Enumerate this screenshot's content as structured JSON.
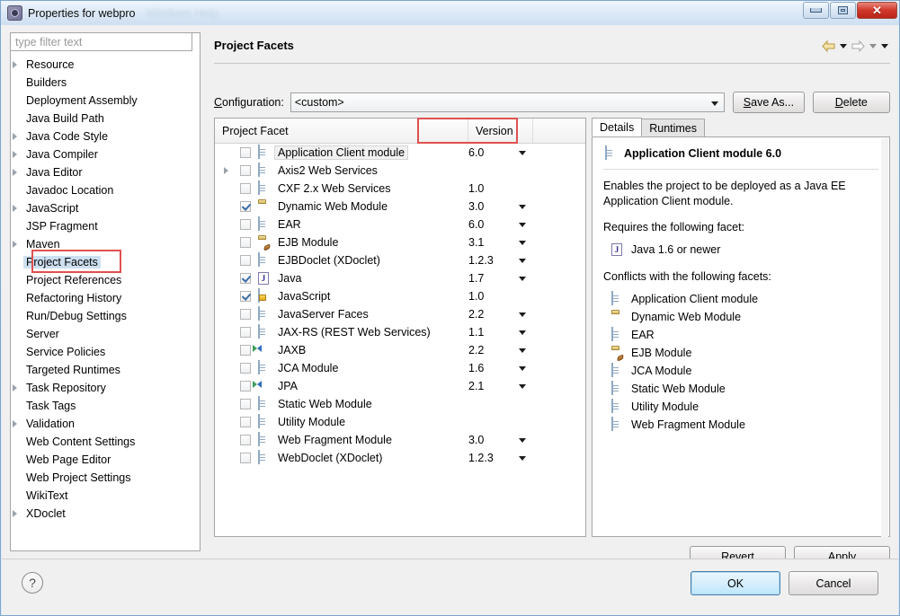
{
  "window": {
    "title": "Properties for webpro",
    "ghost_text": "Windows   Help",
    "minimize": "minimize",
    "restore": "restore",
    "close": "✕"
  },
  "sidebar": {
    "filter_placeholder": "type filter text",
    "items": [
      {
        "label": "Resource",
        "expandable": true,
        "selected": false
      },
      {
        "label": "Builders",
        "expandable": false,
        "selected": false
      },
      {
        "label": "Deployment Assembly",
        "expandable": false,
        "selected": false
      },
      {
        "label": "Java Build Path",
        "expandable": false,
        "selected": false
      },
      {
        "label": "Java Code Style",
        "expandable": true,
        "selected": false
      },
      {
        "label": "Java Compiler",
        "expandable": true,
        "selected": false
      },
      {
        "label": "Java Editor",
        "expandable": true,
        "selected": false
      },
      {
        "label": "Javadoc Location",
        "expandable": false,
        "selected": false
      },
      {
        "label": "JavaScript",
        "expandable": true,
        "selected": false
      },
      {
        "label": "JSP Fragment",
        "expandable": false,
        "selected": false
      },
      {
        "label": "Maven",
        "expandable": true,
        "selected": false
      },
      {
        "label": "Project Facets",
        "expandable": false,
        "selected": true
      },
      {
        "label": "Project References",
        "expandable": false,
        "selected": false
      },
      {
        "label": "Refactoring History",
        "expandable": false,
        "selected": false
      },
      {
        "label": "Run/Debug Settings",
        "expandable": false,
        "selected": false
      },
      {
        "label": "Server",
        "expandable": false,
        "selected": false
      },
      {
        "label": "Service Policies",
        "expandable": false,
        "selected": false
      },
      {
        "label": "Targeted Runtimes",
        "expandable": false,
        "selected": false
      },
      {
        "label": "Task Repository",
        "expandable": true,
        "selected": false
      },
      {
        "label": "Task Tags",
        "expandable": false,
        "selected": false
      },
      {
        "label": "Validation",
        "expandable": true,
        "selected": false
      },
      {
        "label": "Web Content Settings",
        "expandable": false,
        "selected": false
      },
      {
        "label": "Web Page Editor",
        "expandable": false,
        "selected": false
      },
      {
        "label": "Web Project Settings",
        "expandable": false,
        "selected": false
      },
      {
        "label": "WikiText",
        "expandable": false,
        "selected": false
      },
      {
        "label": "XDoclet",
        "expandable": true,
        "selected": false
      }
    ]
  },
  "page": {
    "title": "Project Facets",
    "nav_back_icon": "back-arrow-icon",
    "nav_forward_icon": "forward-arrow-icon"
  },
  "configuration": {
    "label": "Configuration:",
    "value": "<custom>",
    "save_as_label": "Save As...",
    "delete_label": "Delete"
  },
  "facet_table": {
    "columns": [
      "Project Facet",
      "Version",
      ""
    ],
    "rows": [
      {
        "name": "Application Client module",
        "version": "6.0",
        "checked": false,
        "has_dropdown": true,
        "expandable": false,
        "selected": true,
        "icon": "doc"
      },
      {
        "name": "Axis2 Web Services",
        "version": "",
        "checked": false,
        "has_dropdown": false,
        "expandable": true,
        "selected": false,
        "icon": "doc"
      },
      {
        "name": "CXF 2.x Web Services",
        "version": "1.0",
        "checked": false,
        "has_dropdown": false,
        "expandable": false,
        "selected": false,
        "icon": "doc"
      },
      {
        "name": "Dynamic Web Module",
        "version": "3.0",
        "checked": true,
        "has_dropdown": true,
        "expandable": false,
        "selected": false,
        "icon": "web"
      },
      {
        "name": "EAR",
        "version": "6.0",
        "checked": false,
        "has_dropdown": true,
        "expandable": false,
        "selected": false,
        "icon": "doc"
      },
      {
        "name": "EJB Module",
        "version": "3.1",
        "checked": false,
        "has_dropdown": true,
        "expandable": false,
        "selected": false,
        "icon": "ejb"
      },
      {
        "name": "EJBDoclet (XDoclet)",
        "version": "1.2.3",
        "checked": false,
        "has_dropdown": true,
        "expandable": false,
        "selected": false,
        "icon": "doc"
      },
      {
        "name": "Java",
        "version": "1.7",
        "checked": true,
        "has_dropdown": true,
        "expandable": false,
        "selected": false,
        "icon": "java"
      },
      {
        "name": "JavaScript",
        "version": "1.0",
        "checked": true,
        "has_dropdown": false,
        "expandable": false,
        "selected": false,
        "icon": "js"
      },
      {
        "name": "JavaServer Faces",
        "version": "2.2",
        "checked": false,
        "has_dropdown": true,
        "expandable": false,
        "selected": false,
        "icon": "doc"
      },
      {
        "name": "JAX-RS (REST Web Services)",
        "version": "1.1",
        "checked": false,
        "has_dropdown": true,
        "expandable": false,
        "selected": false,
        "icon": "doc"
      },
      {
        "name": "JAXB",
        "version": "2.2",
        "checked": false,
        "has_dropdown": true,
        "expandable": false,
        "selected": false,
        "icon": "arrows"
      },
      {
        "name": "JCA Module",
        "version": "1.6",
        "checked": false,
        "has_dropdown": true,
        "expandable": false,
        "selected": false,
        "icon": "doc"
      },
      {
        "name": "JPA",
        "version": "2.1",
        "checked": false,
        "has_dropdown": true,
        "expandable": false,
        "selected": false,
        "icon": "arrows"
      },
      {
        "name": "Static Web Module",
        "version": "",
        "checked": false,
        "has_dropdown": false,
        "expandable": false,
        "selected": false,
        "icon": "doc"
      },
      {
        "name": "Utility Module",
        "version": "",
        "checked": false,
        "has_dropdown": false,
        "expandable": false,
        "selected": false,
        "icon": "doc"
      },
      {
        "name": "Web Fragment Module",
        "version": "3.0",
        "checked": false,
        "has_dropdown": true,
        "expandable": false,
        "selected": false,
        "icon": "doc"
      },
      {
        "name": "WebDoclet (XDoclet)",
        "version": "1.2.3",
        "checked": false,
        "has_dropdown": true,
        "expandable": false,
        "selected": false,
        "icon": "doc"
      }
    ]
  },
  "details": {
    "tabs": [
      {
        "label": "Details",
        "active": true
      },
      {
        "label": "Runtimes",
        "active": false
      }
    ],
    "heading": "Application Client module 6.0",
    "heading_icon": "doc",
    "description": "Enables the project to be deployed as a Java EE Application Client module.",
    "requires_label": "Requires the following facet:",
    "requires": [
      {
        "label": "Java 1.6 or newer",
        "icon": "java"
      }
    ],
    "conflicts_label": "Conflicts with the following facets:",
    "conflicts": [
      {
        "label": "Application Client module",
        "icon": "doc"
      },
      {
        "label": "Dynamic Web Module",
        "icon": "web"
      },
      {
        "label": "EAR",
        "icon": "doc"
      },
      {
        "label": "EJB Module",
        "icon": "ejb"
      },
      {
        "label": "JCA Module",
        "icon": "doc"
      },
      {
        "label": "Static Web Module",
        "icon": "doc"
      },
      {
        "label": "Utility Module",
        "icon": "doc"
      },
      {
        "label": "Web Fragment Module",
        "icon": "doc"
      }
    ]
  },
  "actions": {
    "revert_label": "Revert",
    "apply_label": "Apply",
    "help_label": "?",
    "ok_label": "OK",
    "cancel_label": "Cancel"
  },
  "annotations": {
    "accent_color": "#e05050",
    "boxes": [
      "project-facets-sidebar-item",
      "project-facet-column-header"
    ]
  }
}
